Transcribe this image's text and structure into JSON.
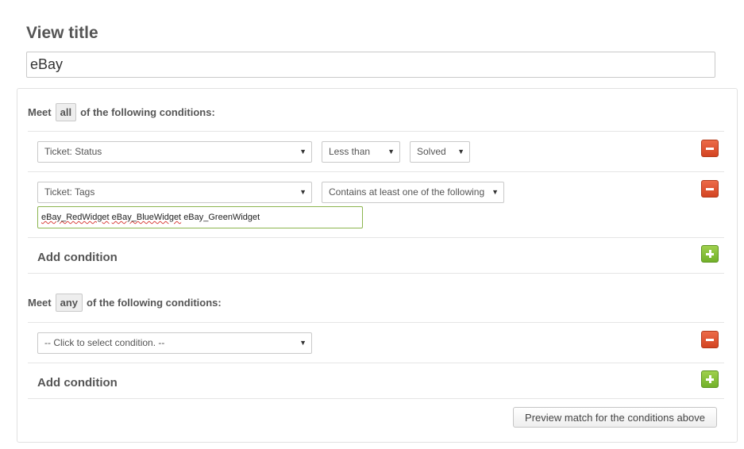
{
  "view": {
    "title_label": "View title",
    "title_value": "eBay"
  },
  "all_group": {
    "prefix": "Meet",
    "mode": "all",
    "suffix": "of the following conditions:",
    "conditions": [
      {
        "field": "Ticket: Status",
        "operator": "Less than",
        "value": "Solved"
      },
      {
        "field": "Ticket: Tags",
        "operator": "Contains at least one of the following",
        "tags": [
          "eBay_RedWidget",
          "eBay_BlueWidget",
          "eBay_GreenWidget"
        ]
      }
    ],
    "add_label": "Add condition"
  },
  "any_group": {
    "prefix": "Meet",
    "mode": "any",
    "suffix": "of the following conditions:",
    "conditions": [
      {
        "field": "-- Click to select condition. --"
      }
    ],
    "add_label": "Add condition"
  },
  "preview_button_label": "Preview match for the conditions above",
  "icons": {
    "caret": "▼",
    "remove": "minus-icon",
    "add": "plus-icon"
  },
  "colors": {
    "remove_button": "#d9532f",
    "add_button": "#84bd36",
    "tags_field_border": "#8cb54f"
  }
}
